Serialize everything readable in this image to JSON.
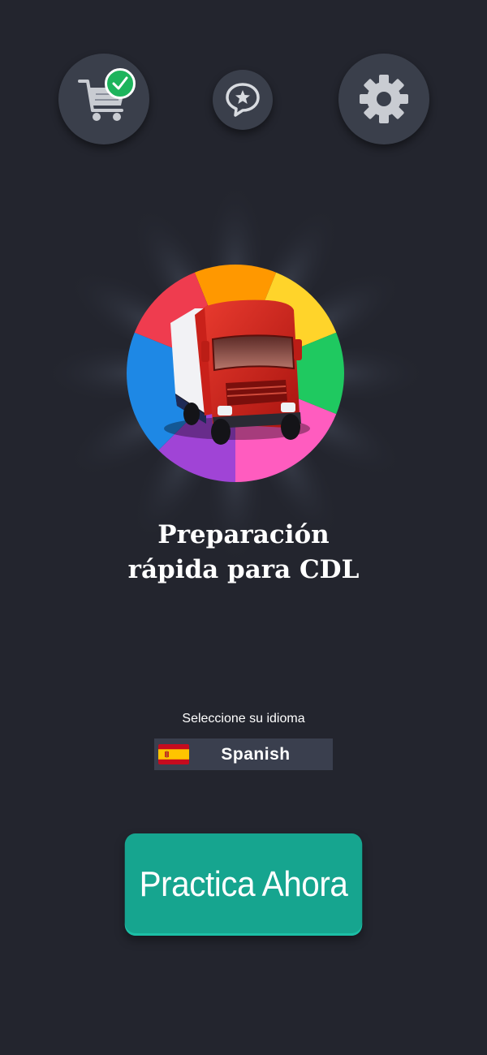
{
  "top_bar": {
    "cart_icon": "shopping-cart-icon",
    "cart_badge_icon": "checkmark-icon",
    "review_icon": "star-speech-bubble-icon",
    "settings_icon": "gear-icon"
  },
  "hero": {
    "logo_icon": "red-truck-icon",
    "ring_colors": [
      "#ff9800",
      "#ffd42a",
      "#1fc960",
      "#ff5cbf",
      "#a044d6",
      "#1e88e5",
      "#ef3c4f"
    ]
  },
  "title": "Preparación\nrápida para CDL",
  "language": {
    "prompt": "Seleccione su idioma",
    "flag_icon": "spain-flag-icon",
    "selected": "Spanish"
  },
  "cta": {
    "label": "Practica Ahora"
  },
  "colors": {
    "background": "#23252e",
    "button": "#16a58f",
    "badge": "#1db45c"
  }
}
